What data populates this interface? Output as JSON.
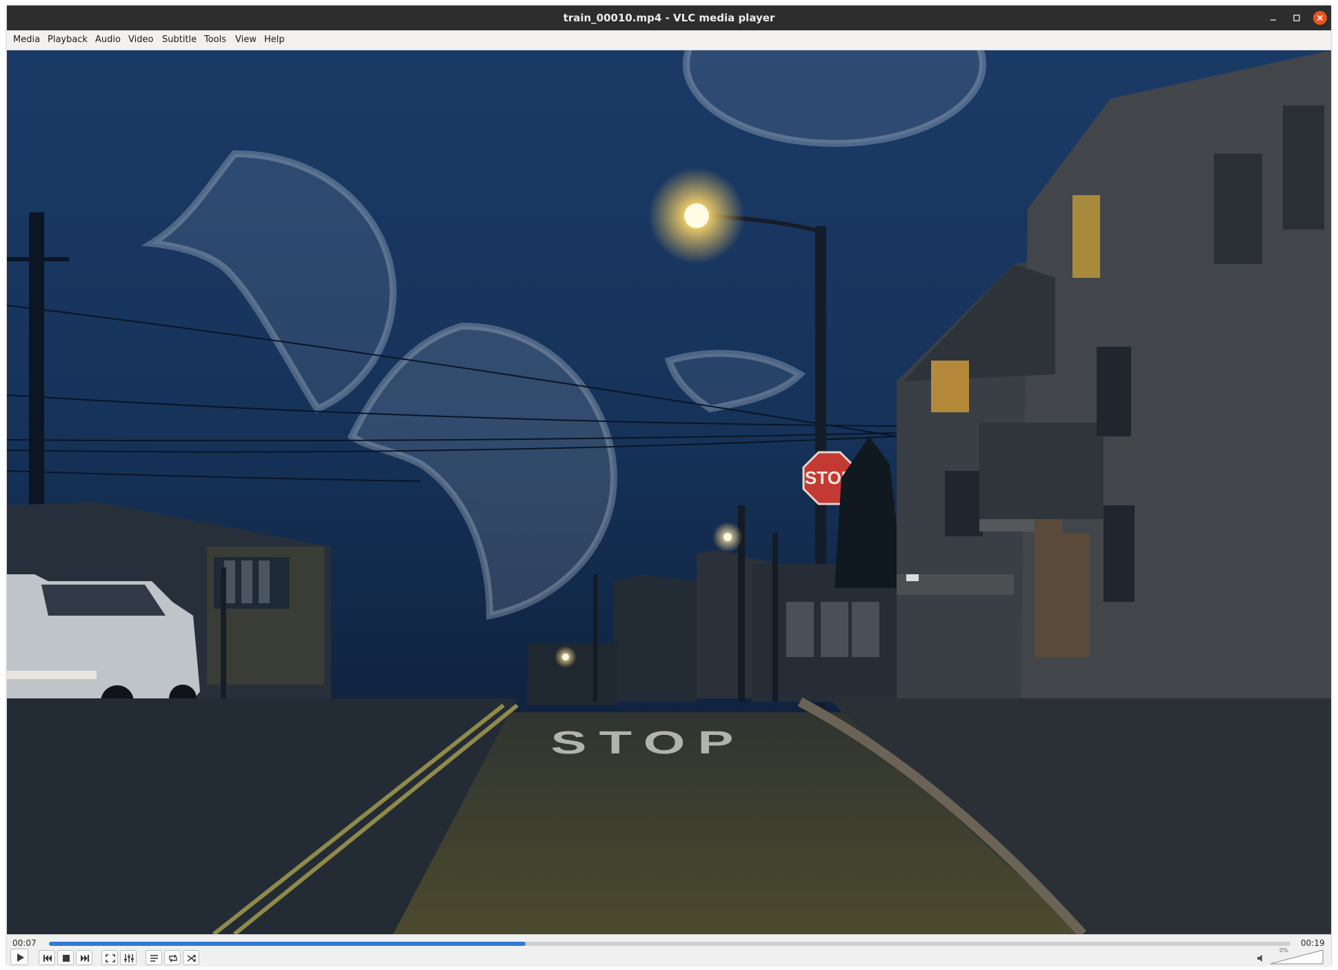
{
  "window": {
    "title": "train_00010.mp4 - VLC media player"
  },
  "menu": [
    "Media",
    "Playback",
    "Audio",
    "Video",
    "Subtitle",
    "Tools",
    "View",
    "Help"
  ],
  "video": {
    "street_text": "STOP",
    "sign_text": "STOP"
  },
  "playback": {
    "elapsed": "00:07",
    "total": "00:19",
    "progress_fraction": 0.384
  },
  "volume": {
    "label": "0%",
    "level_fraction": 0.0
  },
  "colors": {
    "accent": "#2f7ad6",
    "titlebar": "#2d2d2d",
    "close": "#e9541f"
  },
  "icons": [
    "minimize-icon",
    "maximize-icon",
    "close-icon",
    "play-icon",
    "previous-icon",
    "stop-icon",
    "next-icon",
    "fullscreen-icon",
    "extended-settings-icon",
    "playlist-icon",
    "loop-icon",
    "shuffle-icon",
    "speaker-icon"
  ]
}
